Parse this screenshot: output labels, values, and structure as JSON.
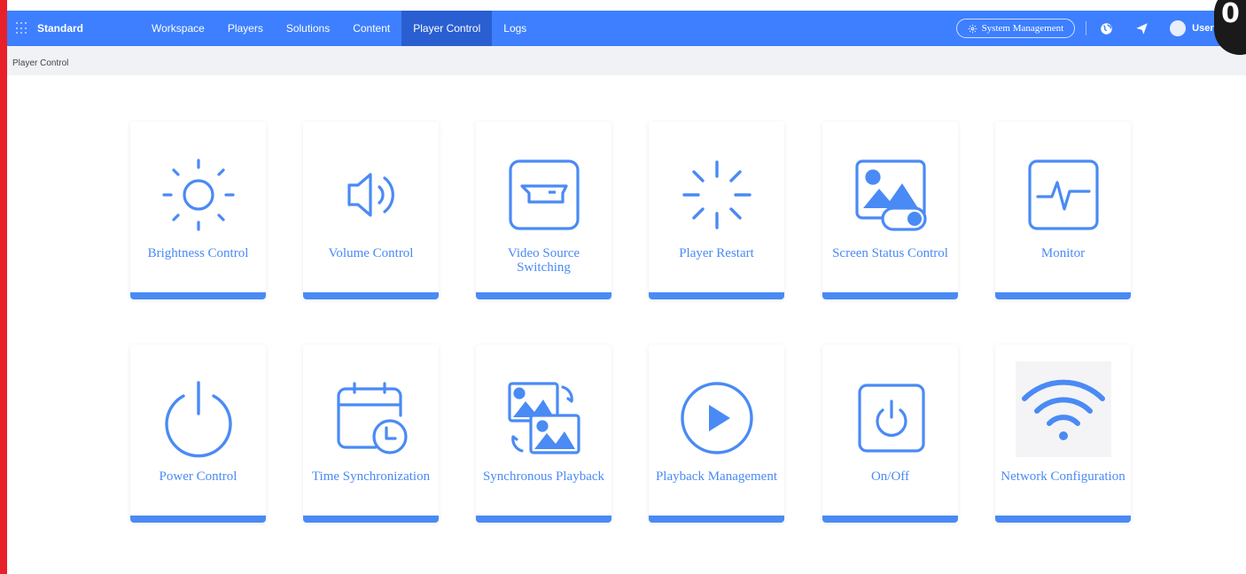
{
  "header": {
    "brand": "Standard",
    "nav": [
      {
        "label": "Workspace"
      },
      {
        "label": "Players"
      },
      {
        "label": "Solutions"
      },
      {
        "label": "Content"
      },
      {
        "label": "Player Control",
        "active": true
      },
      {
        "label": "Logs"
      }
    ],
    "system_management": "System Management",
    "user": "User V",
    "corner_badge": "0"
  },
  "breadcrumb": "Player Control",
  "cards": [
    {
      "label": "Brightness Control",
      "icon": "sun-icon"
    },
    {
      "label": "Volume Control",
      "icon": "speaker-icon"
    },
    {
      "label": "Video Source Switching",
      "icon": "video-source-icon"
    },
    {
      "label": "Player Restart",
      "icon": "restart-spinner-icon"
    },
    {
      "label": "Screen Status Control",
      "icon": "screen-toggle-icon"
    },
    {
      "label": "Monitor",
      "icon": "heartbeat-monitor-icon"
    },
    {
      "label": "Power Control",
      "icon": "power-icon"
    },
    {
      "label": "Time Synchronization",
      "icon": "calendar-clock-icon"
    },
    {
      "label": "Synchronous Playback",
      "icon": "sync-images-icon"
    },
    {
      "label": "Playback Management",
      "icon": "play-circle-icon"
    },
    {
      "label": "On/Off",
      "icon": "power-square-icon"
    },
    {
      "label": "Network Configuration",
      "icon": "wifi-icon"
    }
  ],
  "colors": {
    "nav": "#3d7fff",
    "nav_active": "#2a5fd1",
    "accent": "#4a8af5",
    "frame": "#e8202a"
  }
}
